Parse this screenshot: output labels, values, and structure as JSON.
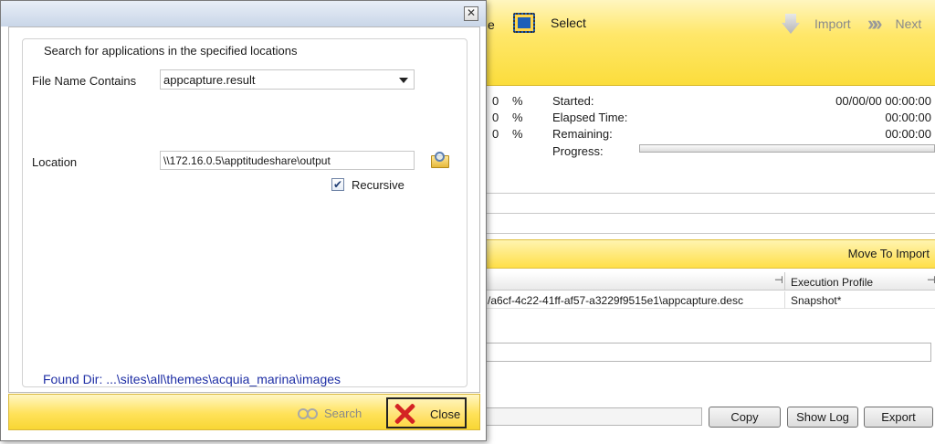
{
  "toolbar": {
    "partial_label": "e",
    "select_label": "Select",
    "import_label": "Import",
    "next_label": "Next"
  },
  "stats": {
    "rows": [
      {
        "num": "0",
        "pct": "%",
        "label": "Started:",
        "value": "00/00/00 00:00:00"
      },
      {
        "num": "0",
        "pct": "%",
        "label": "Elapsed Time:",
        "value": "00:00:00"
      },
      {
        "num": "0",
        "pct": "%",
        "label": "Remaining:",
        "value": "00:00:00"
      }
    ],
    "progress_label": "Progress:",
    "progress_fraction": 0
  },
  "move_bar": {
    "label": "Move To Import"
  },
  "grid": {
    "header_exec": "Execution Profile",
    "pin_glyph": "⊣",
    "row": {
      "path": "/a6cf-4c22-41ff-af57-a3229f9515e1\\appcapture.desc",
      "exec": "Snapshot*"
    }
  },
  "bottom_buttons": {
    "copy": "Copy",
    "show_log": "Show Log",
    "export": "Export"
  },
  "dialog": {
    "close_glyph": "✕",
    "group_title": "Search for applications in the specified locations",
    "file_name_label": "File Name Contains",
    "file_name_value": "appcapture.result",
    "location_label": "Location",
    "location_value": "\\\\172.16.0.5\\apptitudeshare\\output",
    "recursive_label": "Recursive",
    "recursive_checked": true,
    "check_glyph": "✔",
    "found_dir": "Found Dir: ...\\sites\\all\\themes\\acquia_marina\\images",
    "search_label": "Search",
    "close_label": "Close"
  },
  "colors": {
    "accent_yellow": "#ffe25a",
    "found_dir_blue": "#1f2fa5",
    "close_x_red": "#d42424"
  },
  "icons": [
    "select-icon",
    "import-icon",
    "next-icon",
    "folder-search-icon",
    "search-binoculars-icon",
    "red-x-icon",
    "pin-icon",
    "close-icon"
  ]
}
